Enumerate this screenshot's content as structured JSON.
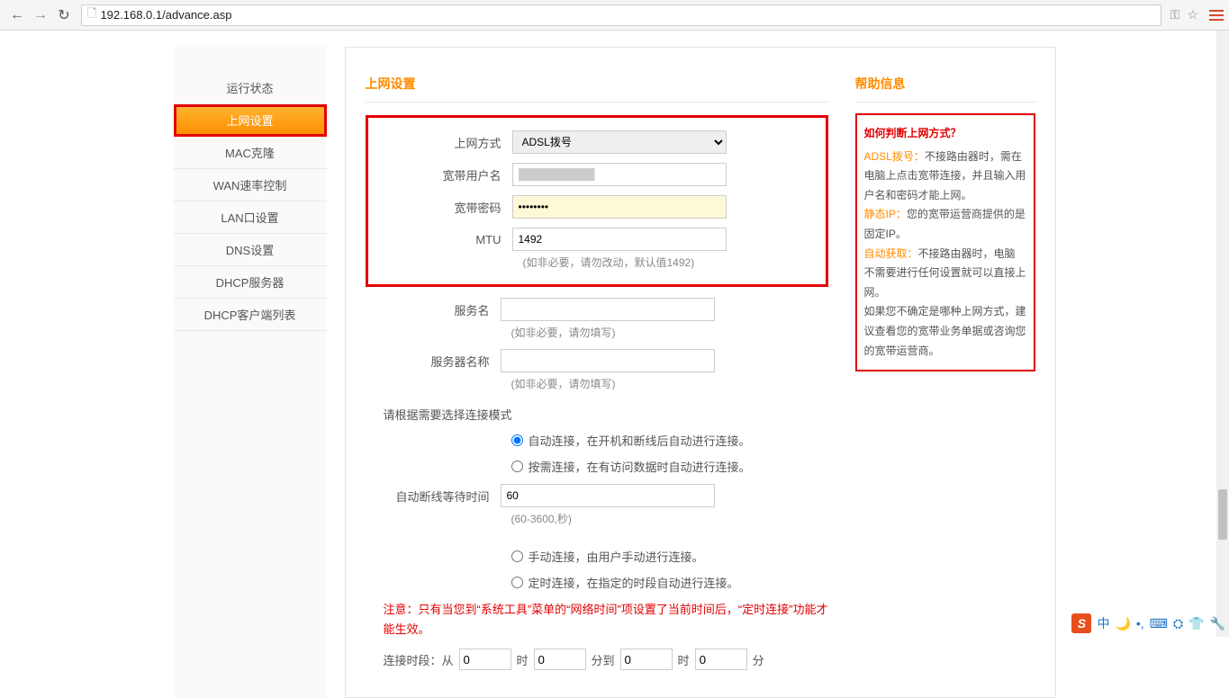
{
  "browser": {
    "url": "192.168.0.1/advance.asp"
  },
  "sidebar": {
    "items": [
      {
        "label": "运行状态"
      },
      {
        "label": "上网设置"
      },
      {
        "label": "MAC克隆"
      },
      {
        "label": "WAN速率控制"
      },
      {
        "label": "LAN口设置"
      },
      {
        "label": "DNS设置"
      },
      {
        "label": "DHCP服务器"
      },
      {
        "label": "DHCP客户端列表"
      }
    ]
  },
  "main": {
    "title": "上网设置",
    "labels": {
      "conn_type": "上网方式",
      "username": "宽带用户名",
      "password": "宽带密码",
      "mtu": "MTU",
      "service": "服务名",
      "server": "服务器名称",
      "idle": "自动断线等待时间"
    },
    "values": {
      "conn_type": "ADSL拨号",
      "username_placeholder": "",
      "password": "••••••••",
      "mtu": "1492",
      "mtu_hint": "(如非必要，请勿改动，默认值1492)",
      "service": "",
      "service_hint": "(如非必要，请勿填写)",
      "server": "",
      "server_hint": "(如非必要，请勿填写)",
      "idle": "60",
      "idle_hint": "(60-3600,秒)"
    },
    "mode_title": "请根据需要选择连接模式",
    "modes": {
      "auto": "自动连接，在开机和断线后自动进行连接。",
      "demand": "按需连接，在有访问数据时自动进行连接。",
      "manual": "手动连接，由用户手动进行连接。",
      "scheduled": "定时连接，在指定的时段自动进行连接。"
    },
    "warning": "注意：只有当您到“系统工具”菜单的“网络时间”项设置了当前时间后，“定时连接”功能才能生效。",
    "time_row": {
      "prefix": "连接时段：从",
      "h1": "0",
      "sep_h": "时",
      "m1": "0",
      "sep_to": "分到",
      "h2": "0",
      "m2": "0",
      "sep_end": "分"
    }
  },
  "help": {
    "title": "帮助信息",
    "question": "如何判断上网方式？",
    "items": [
      {
        "label": "ADSL拨号：",
        "text": "不接路由器时，需在电脑上点击宽带连接，并且输入用户名和密码才能上网。"
      },
      {
        "label": "静态IP：",
        "text": "您的宽带运营商提供的是固定IP。"
      },
      {
        "label": "自动获取：",
        "text": "不接路由器时，电脑不需要进行任何设置就可以直接上网。"
      }
    ],
    "footer": "如果您不确定是哪种上网方式，建议查看您的宽带业务单据或咨询您的宽带运营商。"
  },
  "tray": {
    "chars": [
      "中",
      "🌙",
      "•,",
      "⌨",
      "⛭",
      "👕",
      "🔧"
    ]
  }
}
